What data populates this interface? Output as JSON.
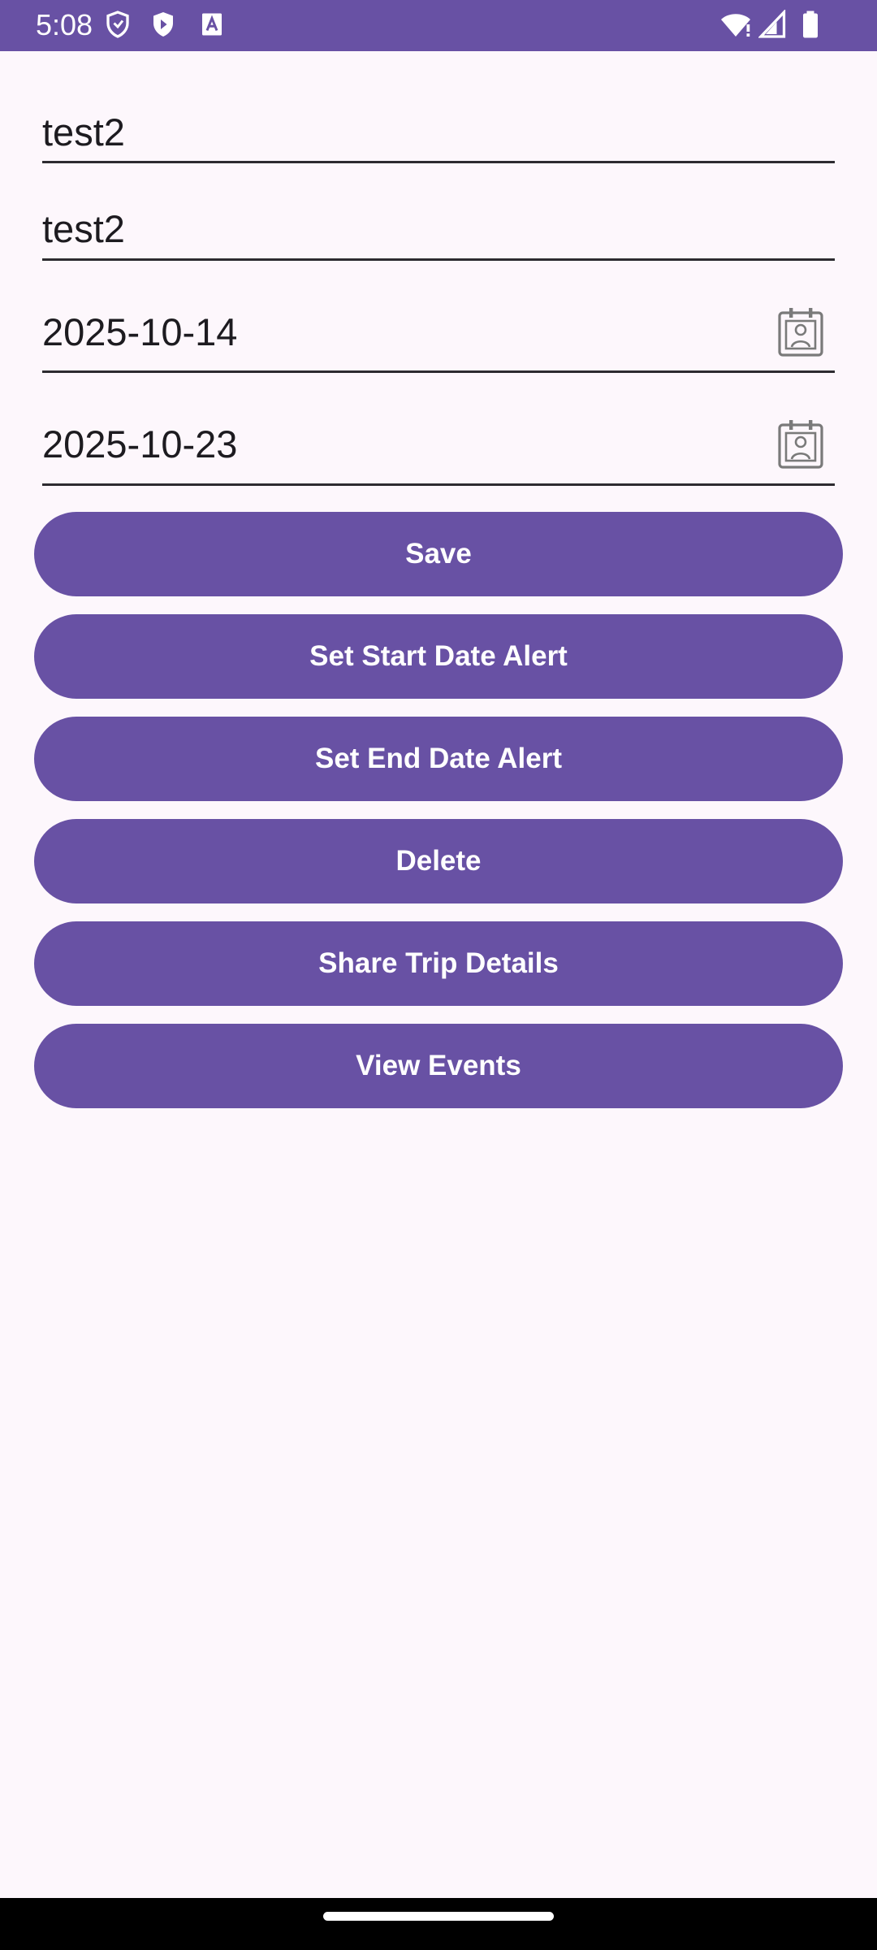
{
  "status_bar": {
    "time": "5:08",
    "left_icons": [
      "shield-outline-icon",
      "play-shield-icon",
      "keyboard-a-icon"
    ],
    "right_icons": [
      "wifi-icon",
      "cell-signal-icon",
      "battery-icon"
    ],
    "background": "#6851a4"
  },
  "form": {
    "fields": [
      {
        "value": "test2"
      },
      {
        "value": "test2"
      },
      {
        "value": "2025-10-14",
        "icon": "calendar-contact-icon"
      },
      {
        "value": "2025-10-23",
        "icon": "calendar-contact-icon"
      }
    ]
  },
  "buttons": {
    "save": "Save",
    "set_start_alert": "Set Start Date Alert",
    "set_end_alert": "Set End Date Alert",
    "delete": "Delete",
    "share": "Share Trip Details",
    "view_events": "View Events"
  },
  "colors": {
    "accent": "#6851a4",
    "background": "#fdf7fc",
    "text": "#1d1b20"
  }
}
